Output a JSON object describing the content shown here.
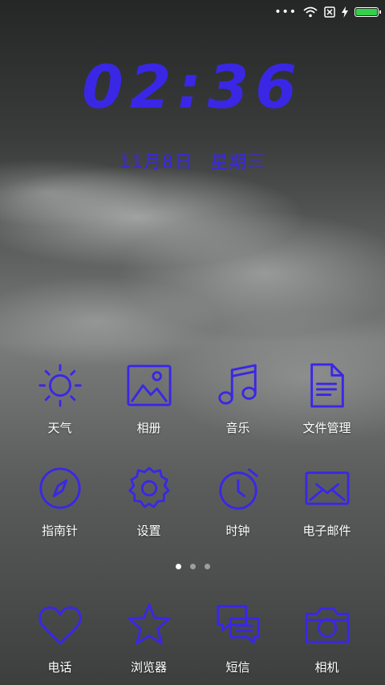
{
  "status_bar": {
    "icons": [
      "more-dots-icon",
      "wifi-icon",
      "no-sim-icon",
      "charging-icon",
      "battery-icon"
    ],
    "battery_level": 1.0,
    "battery_color": "#35d04a"
  },
  "clock": {
    "time": "02:36"
  },
  "date": {
    "day": "11月8日",
    "weekday": "星期三"
  },
  "accent_color": "#3a27e6",
  "apps_row1": [
    {
      "label": "天气",
      "icon": "sun-icon"
    },
    {
      "label": "相册",
      "icon": "gallery-icon"
    },
    {
      "label": "音乐",
      "icon": "music-note-icon"
    },
    {
      "label": "文件管理",
      "icon": "document-icon"
    }
  ],
  "apps_row2": [
    {
      "label": "指南针",
      "icon": "compass-icon"
    },
    {
      "label": "设置",
      "icon": "gear-icon"
    },
    {
      "label": "时钟",
      "icon": "stopwatch-icon"
    },
    {
      "label": "电子邮件",
      "icon": "envelope-icon"
    }
  ],
  "page_indicator": {
    "count": 3,
    "current": 1
  },
  "dock": [
    {
      "label": "电话",
      "icon": "heart-icon"
    },
    {
      "label": "浏览器",
      "icon": "star-icon"
    },
    {
      "label": "短信",
      "icon": "chat-bubbles-icon"
    },
    {
      "label": "相机",
      "icon": "camera-icon"
    }
  ]
}
